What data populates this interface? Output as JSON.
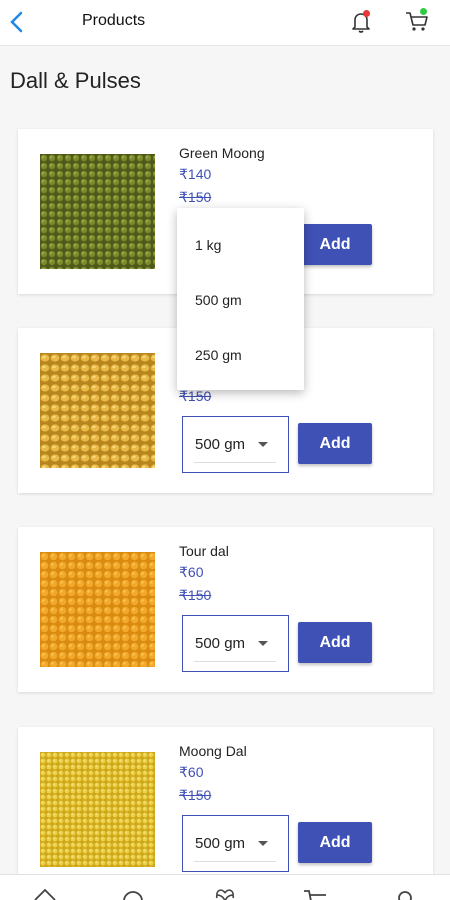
{
  "header": {
    "title": "Products",
    "back_icon": "back-arrow-icon",
    "notification_icon": "bell-icon",
    "cart_icon": "cart-icon"
  },
  "section": {
    "title": "Dall & Pulses"
  },
  "products": [
    {
      "name": "Green Moong",
      "price": "₹140",
      "mrp": "₹150",
      "qty": "1 kg",
      "add_label": "Add"
    },
    {
      "name": "",
      "price": "",
      "mrp": "₹150",
      "qty": "500 gm",
      "add_label": "Add"
    },
    {
      "name": "Tour dal",
      "price": "₹60",
      "mrp": "₹150",
      "qty": "500 gm",
      "add_label": "Add"
    },
    {
      "name": "Moong Dal",
      "price": "₹60",
      "mrp": "₹150",
      "qty": "500 gm",
      "add_label": "Add"
    }
  ],
  "dropdown": {
    "options": [
      "1 kg",
      "500 gm",
      "250 gm"
    ]
  },
  "bottom_nav": {
    "icons": [
      "home-icon",
      "search-icon",
      "heart-icon",
      "cart-icon",
      "profile-icon"
    ]
  },
  "colors": {
    "accent": "#3f51b5",
    "back_arrow": "#1e88e5",
    "notification_dot": "#e53935",
    "cart_dot": "#2ecc40"
  }
}
